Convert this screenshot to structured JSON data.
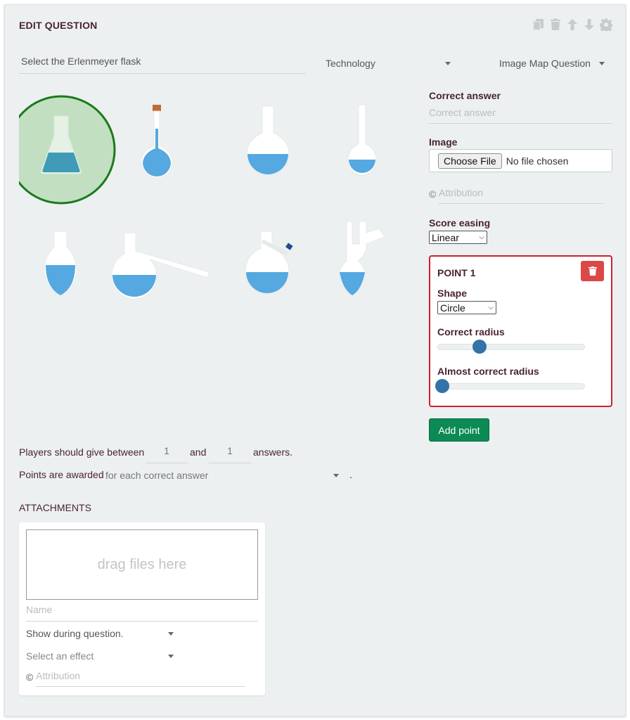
{
  "header": {
    "title": "EDIT QUESTION"
  },
  "toolbar": {
    "icons": [
      "copy-icon",
      "trash-icon",
      "arrow-up-icon",
      "arrow-down-icon",
      "gear-icon"
    ]
  },
  "question": {
    "text": "Select the Erlenmeyer flask",
    "category": "Technology",
    "type": "Image Map Question"
  },
  "right": {
    "correct_answer_label": "Correct answer",
    "correct_answer_placeholder": "Correct answer",
    "image_label": "Image",
    "choose_file": "Choose File",
    "no_file": "No file chosen",
    "copyright": "©",
    "attribution_placeholder": "Attribution",
    "score_easing_label": "Score easing",
    "score_easing_value": "Linear"
  },
  "point": {
    "title": "POINT 1",
    "shape_label": "Shape",
    "shape_value": "Circle",
    "correct_radius_label": "Correct radius",
    "correct_radius_value": 0.27,
    "almost_radius_label": "Almost correct radius",
    "almost_radius_value": 0.0,
    "add_point": "Add point"
  },
  "answers": {
    "prefix": "Players should give between",
    "min": "1",
    "and": "and",
    "max": "1",
    "suffix": "answers."
  },
  "points_awarded": {
    "prefix": "Points are awarded",
    "value": "for each correct answer",
    "suffix": "."
  },
  "attachments": {
    "title": "ATTACHMENTS",
    "drop": "drag files here",
    "name_placeholder": "Name",
    "show": "Show during question.",
    "effect": "Select an effect",
    "copyright": "©",
    "attribution_placeholder": "Attribution"
  },
  "colors": {
    "liquid": "#55a8e0",
    "glass": "#ffffff",
    "highlight_fill": "#c2dfc2",
    "highlight_stroke": "#1a7a1a",
    "accent_green": "#0c8a55",
    "danger": "#dc4848",
    "slider": "#3472a8"
  }
}
